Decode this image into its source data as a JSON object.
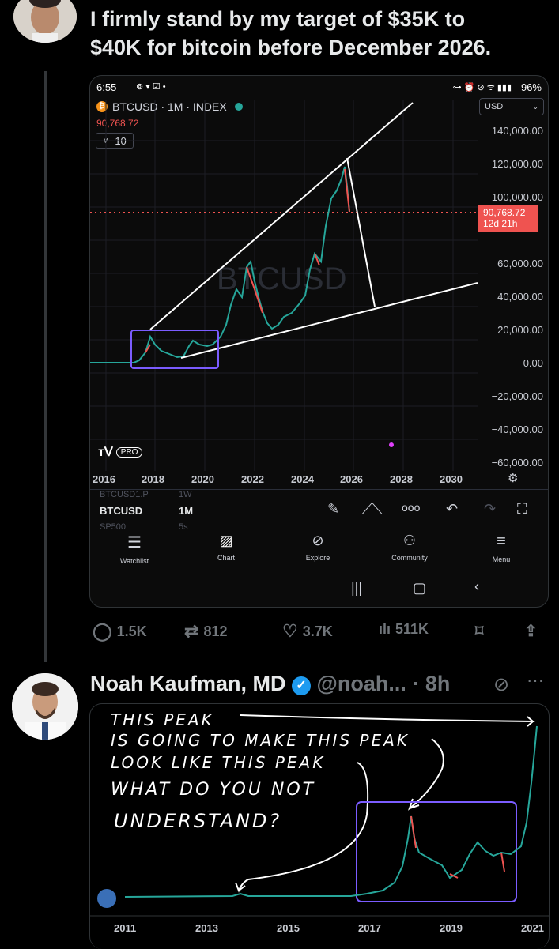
{
  "tweet1": {
    "text_line1": "I firmly stand by my target of $35K to",
    "text_line2": "$40K for bitcoin before December 2026.",
    "actions": {
      "replies": "1.5K",
      "reposts": "812",
      "likes": "3.7K",
      "views": "511K"
    }
  },
  "phone": {
    "status_time": "6:55",
    "battery": "96%",
    "symbol_line": "BTCUSD · 1M · INDEX",
    "symbol_price": "90,768.72",
    "interval": "10",
    "currency": "USD",
    "watermark": "BTCUSD",
    "price_tag": "90,768.72",
    "countdown": "12d 21h",
    "y_ticks": [
      "140,000.00",
      "120,000.00",
      "100,000.00",
      "60,000.00",
      "40,000.00",
      "20,000.00",
      "0.00",
      "−20,000.00",
      "−40,000.00",
      "−60,000.00"
    ],
    "x_ticks": [
      "2016",
      "2018",
      "2020",
      "2022",
      "2024",
      "2026",
      "2028",
      "2030"
    ],
    "logo_text": "PRO",
    "watch_partial_top": "BTCUSD1.P",
    "watch_partial_top_interval": "1W",
    "watch_row_symbol": "BTCUSD",
    "watch_row_interval": "1M",
    "watch_partial_bottom": "SP500",
    "watch_partial_bottom_interval": "5s",
    "nav": [
      "Watchlist",
      "Chart",
      "Explore",
      "Community",
      "Menu"
    ]
  },
  "tweet2": {
    "name": "Noah Kaufman, MD",
    "handle": "@noah...",
    "time": "· 8h",
    "note_lines": [
      "THIS  PEAK",
      "IS  GOING  TO  MAKE  THIS  PEAK",
      "LOOK  LIKE  THIS  PEAK",
      "WHAT  DO  YOU  NOT",
      "UNDERSTAND?"
    ],
    "x_ticks": [
      "2011",
      "2013",
      "2015",
      "2017",
      "2019",
      "2021"
    ]
  },
  "colors": {
    "accent_blue": "#1d9bf0",
    "up": "#26a69a",
    "down": "#ef5350",
    "box": "#7b5cff"
  }
}
